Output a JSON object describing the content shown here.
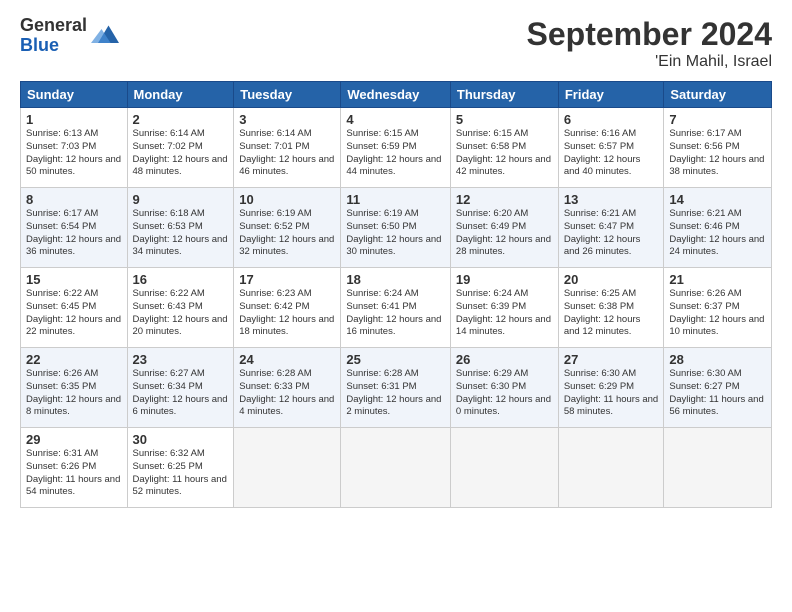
{
  "logo": {
    "general": "General",
    "blue": "Blue"
  },
  "title": "September 2024",
  "location": "'Ein Mahil, Israel",
  "days_of_week": [
    "Sunday",
    "Monday",
    "Tuesday",
    "Wednesday",
    "Thursday",
    "Friday",
    "Saturday"
  ],
  "weeks": [
    [
      {
        "day": "1",
        "sunrise": "6:13 AM",
        "sunset": "7:03 PM",
        "daylight": "12 hours and 50 minutes."
      },
      {
        "day": "2",
        "sunrise": "6:14 AM",
        "sunset": "7:02 PM",
        "daylight": "12 hours and 48 minutes."
      },
      {
        "day": "3",
        "sunrise": "6:14 AM",
        "sunset": "7:01 PM",
        "daylight": "12 hours and 46 minutes."
      },
      {
        "day": "4",
        "sunrise": "6:15 AM",
        "sunset": "6:59 PM",
        "daylight": "12 hours and 44 minutes."
      },
      {
        "day": "5",
        "sunrise": "6:15 AM",
        "sunset": "6:58 PM",
        "daylight": "12 hours and 42 minutes."
      },
      {
        "day": "6",
        "sunrise": "6:16 AM",
        "sunset": "6:57 PM",
        "daylight": "12 hours and 40 minutes."
      },
      {
        "day": "7",
        "sunrise": "6:17 AM",
        "sunset": "6:56 PM",
        "daylight": "12 hours and 38 minutes."
      }
    ],
    [
      {
        "day": "8",
        "sunrise": "6:17 AM",
        "sunset": "6:54 PM",
        "daylight": "12 hours and 36 minutes."
      },
      {
        "day": "9",
        "sunrise": "6:18 AM",
        "sunset": "6:53 PM",
        "daylight": "12 hours and 34 minutes."
      },
      {
        "day": "10",
        "sunrise": "6:19 AM",
        "sunset": "6:52 PM",
        "daylight": "12 hours and 32 minutes."
      },
      {
        "day": "11",
        "sunrise": "6:19 AM",
        "sunset": "6:50 PM",
        "daylight": "12 hours and 30 minutes."
      },
      {
        "day": "12",
        "sunrise": "6:20 AM",
        "sunset": "6:49 PM",
        "daylight": "12 hours and 28 minutes."
      },
      {
        "day": "13",
        "sunrise": "6:21 AM",
        "sunset": "6:47 PM",
        "daylight": "12 hours and 26 minutes."
      },
      {
        "day": "14",
        "sunrise": "6:21 AM",
        "sunset": "6:46 PM",
        "daylight": "12 hours and 24 minutes."
      }
    ],
    [
      {
        "day": "15",
        "sunrise": "6:22 AM",
        "sunset": "6:45 PM",
        "daylight": "12 hours and 22 minutes."
      },
      {
        "day": "16",
        "sunrise": "6:22 AM",
        "sunset": "6:43 PM",
        "daylight": "12 hours and 20 minutes."
      },
      {
        "day": "17",
        "sunrise": "6:23 AM",
        "sunset": "6:42 PM",
        "daylight": "12 hours and 18 minutes."
      },
      {
        "day": "18",
        "sunrise": "6:24 AM",
        "sunset": "6:41 PM",
        "daylight": "12 hours and 16 minutes."
      },
      {
        "day": "19",
        "sunrise": "6:24 AM",
        "sunset": "6:39 PM",
        "daylight": "12 hours and 14 minutes."
      },
      {
        "day": "20",
        "sunrise": "6:25 AM",
        "sunset": "6:38 PM",
        "daylight": "12 hours and 12 minutes."
      },
      {
        "day": "21",
        "sunrise": "6:26 AM",
        "sunset": "6:37 PM",
        "daylight": "12 hours and 10 minutes."
      }
    ],
    [
      {
        "day": "22",
        "sunrise": "6:26 AM",
        "sunset": "6:35 PM",
        "daylight": "12 hours and 8 minutes."
      },
      {
        "day": "23",
        "sunrise": "6:27 AM",
        "sunset": "6:34 PM",
        "daylight": "12 hours and 6 minutes."
      },
      {
        "day": "24",
        "sunrise": "6:28 AM",
        "sunset": "6:33 PM",
        "daylight": "12 hours and 4 minutes."
      },
      {
        "day": "25",
        "sunrise": "6:28 AM",
        "sunset": "6:31 PM",
        "daylight": "12 hours and 2 minutes."
      },
      {
        "day": "26",
        "sunrise": "6:29 AM",
        "sunset": "6:30 PM",
        "daylight": "12 hours and 0 minutes."
      },
      {
        "day": "27",
        "sunrise": "6:30 AM",
        "sunset": "6:29 PM",
        "daylight": "11 hours and 58 minutes."
      },
      {
        "day": "28",
        "sunrise": "6:30 AM",
        "sunset": "6:27 PM",
        "daylight": "11 hours and 56 minutes."
      }
    ],
    [
      {
        "day": "29",
        "sunrise": "6:31 AM",
        "sunset": "6:26 PM",
        "daylight": "11 hours and 54 minutes."
      },
      {
        "day": "30",
        "sunrise": "6:32 AM",
        "sunset": "6:25 PM",
        "daylight": "11 hours and 52 minutes."
      },
      null,
      null,
      null,
      null,
      null
    ]
  ]
}
